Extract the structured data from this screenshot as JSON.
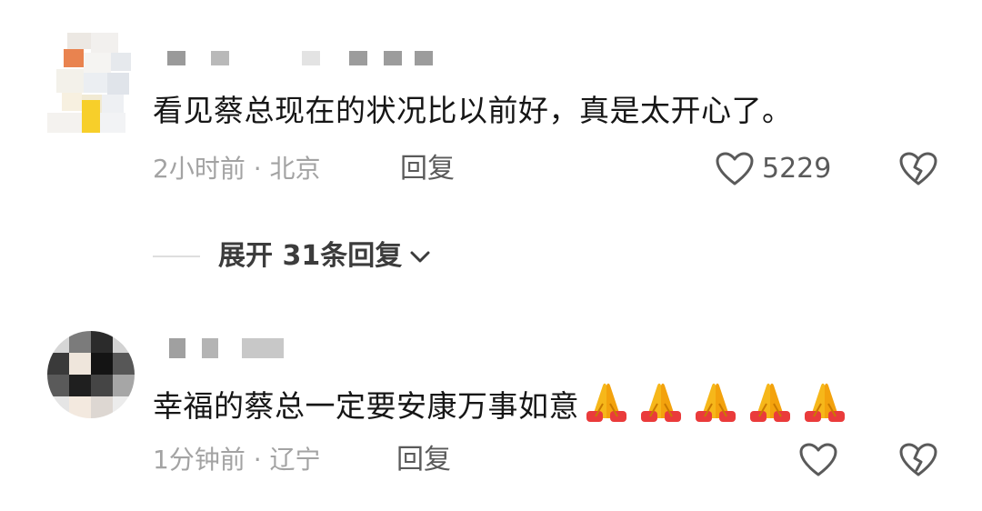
{
  "comments": [
    {
      "text": "看见蔡总现在的状况比以前好，真是太开心了。",
      "time_location": "2小时前 · 北京",
      "reply_label": "回复",
      "like_count": "5229",
      "expand_replies": "展开 31条回复"
    },
    {
      "text": "幸福的蔡总一定要安康万事如意",
      "emoji": [
        "folded-hands",
        "folded-hands",
        "folded-hands",
        "folded-hands",
        "folded-hands"
      ],
      "time_location": "1分钟前 · 辽宁",
      "reply_label": "回复",
      "like_count": ""
    }
  ],
  "colors": {
    "text": "#161616",
    "meta": "#a3a3a3",
    "action": "#5a5a5a",
    "divider": "#dedede"
  }
}
